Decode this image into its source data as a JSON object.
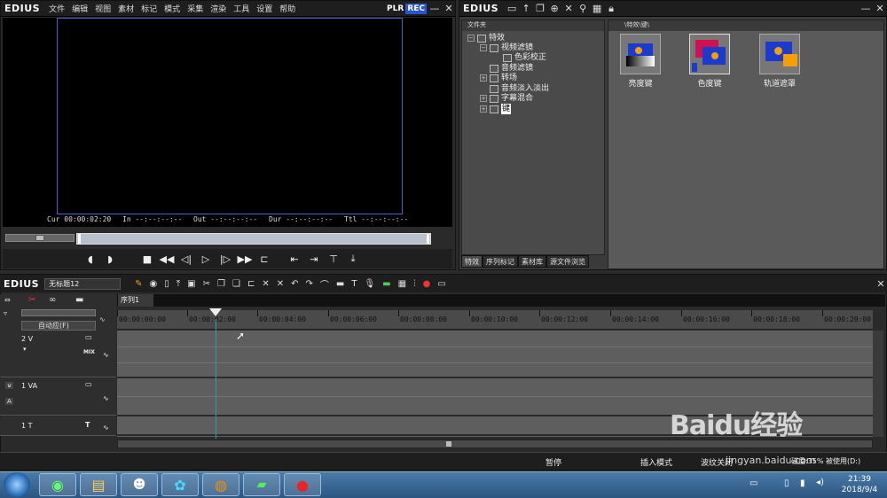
{
  "player": {
    "brand": "EDIUS",
    "menu": [
      "文件",
      "编辑",
      "视图",
      "素材",
      "标记",
      "模式",
      "采集",
      "渲染",
      "工具",
      "设置",
      "帮助"
    ],
    "badge_plr": "PLR",
    "badge_rec": "REC",
    "timecodes": {
      "cur": "Cur 00:00:02:20",
      "in": "In --:--:--:--",
      "out": "Out --:--:--:--",
      "dur": "Dur --:--:--:--",
      "ttl": "Ttl --:--:--:--"
    }
  },
  "effects": {
    "brand": "EDIUS",
    "folder_header": "文件夹",
    "preview_header": "\\特效\\键\\",
    "tree": [
      {
        "label": "特效",
        "level": 0
      },
      {
        "label": "视频滤镜",
        "level": 1
      },
      {
        "label": "色彩校正",
        "level": 2
      },
      {
        "label": "音频滤镜",
        "level": 1
      },
      {
        "label": "转场",
        "level": 1
      },
      {
        "label": "音频淡入淡出",
        "level": 1
      },
      {
        "label": "字幕混合",
        "level": 1
      },
      {
        "label": "键",
        "level": 1
      }
    ],
    "thumbs": [
      {
        "label": "亮度键"
      },
      {
        "label": "色度键"
      },
      {
        "label": "轨道遮罩"
      }
    ],
    "tabs": [
      "特效",
      "序列标记",
      "素材库",
      "源文件浏览"
    ]
  },
  "timeline": {
    "brand": "EDIUS",
    "project_name": "无标题12",
    "sequence_tab": "序列1",
    "mode_select": "自动应(F)",
    "ticks": [
      "00:00:00:00",
      "00:00:02:00",
      "00:00:04:00",
      "00:00:06:00",
      "00:00:08:00",
      "00:00:10:00",
      "00:00:12:00",
      "00:00:14:00",
      "00:00:16:00",
      "00:00:18:00",
      "00:00:20:00"
    ],
    "tracks": [
      {
        "label": "2 V"
      },
      {
        "label": "1 VA"
      },
      {
        "label": "1 T"
      }
    ],
    "mix_label": "MIX"
  },
  "status": {
    "pause": "暂停",
    "insert_mode": "插入模式",
    "ripple": "波纹关闭",
    "disk": "磁盘:35% 被使用(D:)"
  },
  "taskbar": {
    "time": "21:39",
    "date": "2018/9/4"
  },
  "watermark": {
    "text": "Baidu经验",
    "sub": "jingyan.baidu.com"
  }
}
